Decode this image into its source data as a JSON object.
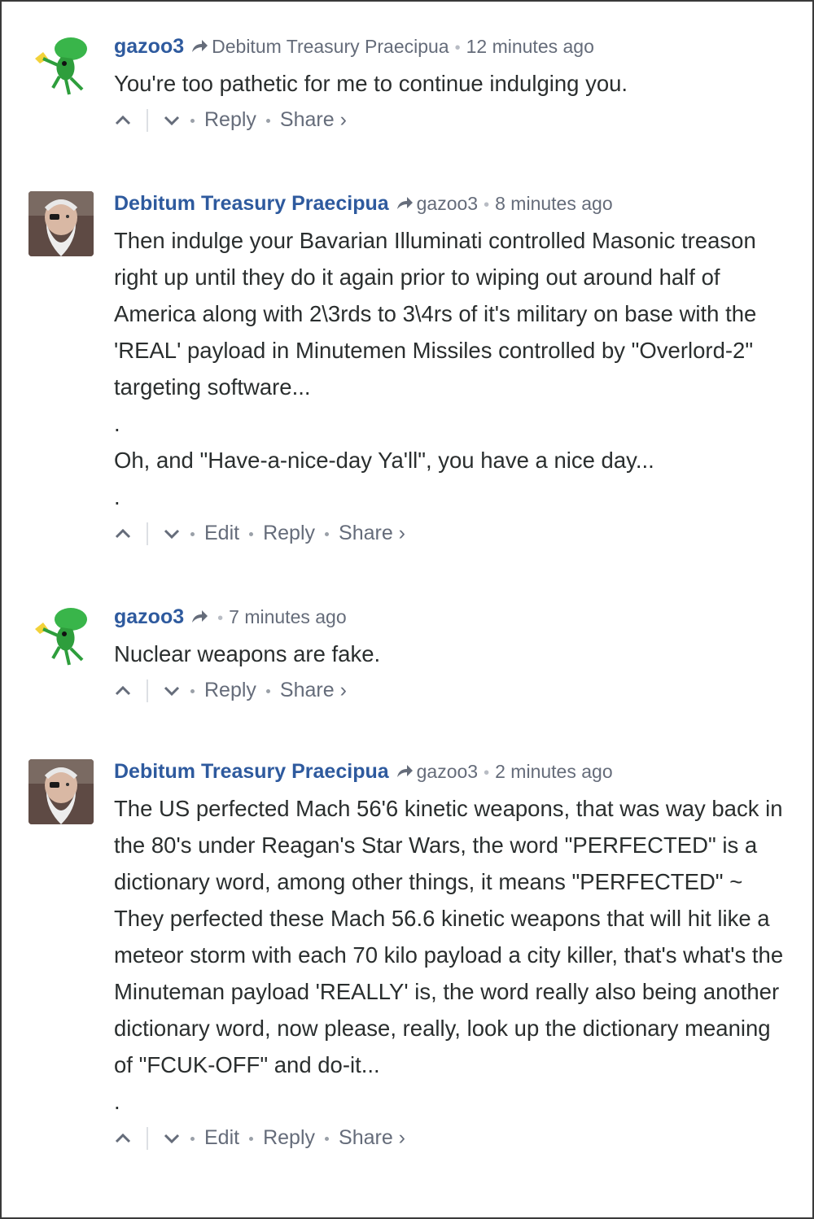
{
  "comments": [
    {
      "author": "gazoo3",
      "in_reply_to": "Debitum Treasury Praecipua",
      "time": "12 minutes ago",
      "avatar": "green-cartoon-avatar",
      "paragraphs": [
        "You're too pathetic for me to continue indulging you."
      ],
      "actions": {
        "reply": "Reply",
        "share": "Share ›"
      }
    },
    {
      "author": "Debitum Treasury Praecipua",
      "in_reply_to": "gazoo3",
      "time": "8 minutes ago",
      "avatar": "bearded-man-photo",
      "paragraphs": [
        "Then indulge your Bavarian Illuminati controlled Masonic treason right up until they do it again prior to wiping out around half of America along with 2\\3rds to 3\\4rs of it's military on base with the 'REAL' payload in Minutemen Missiles controlled by \"Overlord-2\" targeting software...",
        ".",
        "Oh, and \"Have-a-nice-day Ya'll\", you have a nice day...",
        "."
      ],
      "actions": {
        "edit": "Edit",
        "reply": "Reply",
        "share": "Share ›"
      }
    },
    {
      "author": "gazoo3",
      "in_reply_to": "",
      "time": "7 minutes ago",
      "avatar": "green-cartoon-avatar",
      "paragraphs": [
        "Nuclear weapons are fake."
      ],
      "actions": {
        "reply": "Reply",
        "share": "Share ›"
      }
    },
    {
      "author": "Debitum Treasury Praecipua",
      "in_reply_to": "gazoo3",
      "time": "2 minutes ago",
      "avatar": "bearded-man-photo",
      "paragraphs": [
        "The US perfected Mach 56'6 kinetic weapons, that was way back in the 80's under Reagan's Star Wars, the word \"PERFECTED\" is a dictionary word, among other things, it means \"PERFECTED\" ~ They perfected these Mach 56.6 kinetic weapons that will hit like a meteor storm with each 70 kilo payload a city killer, that's what's the Minuteman payload 'REALLY' is, the word really also being another dictionary word, now please, really, look up the dictionary meaning of \"FCUK-OFF\" and do-it...",
        "."
      ],
      "actions": {
        "edit": "Edit",
        "reply": "Reply",
        "share": "Share ›"
      }
    }
  ],
  "colors": {
    "author": "#2e5a9e",
    "meta": "#656c7a",
    "text": "#2a2e2e"
  }
}
